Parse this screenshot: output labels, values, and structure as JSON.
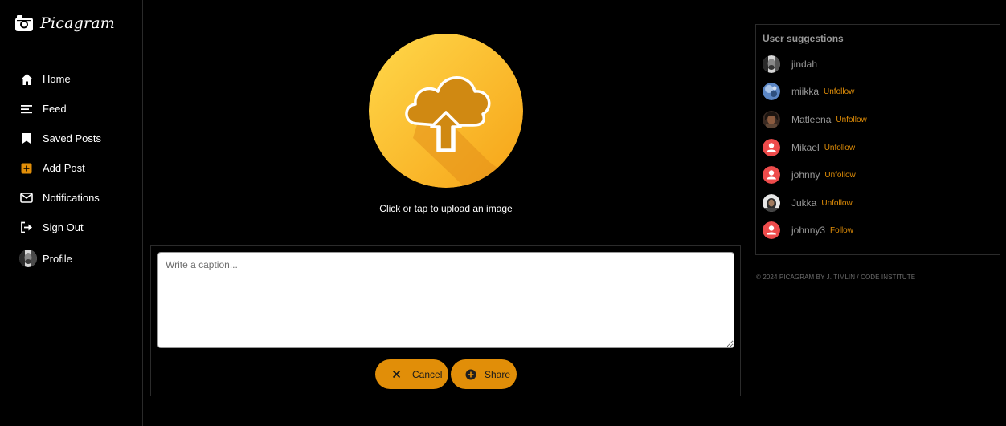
{
  "brand": {
    "name": "Picagram",
    "logo_icon": "camera-icon"
  },
  "nav": {
    "items": [
      {
        "label": "Home",
        "icon": "home-icon"
      },
      {
        "label": "Feed",
        "icon": "feed-icon"
      },
      {
        "label": "Saved Posts",
        "icon": "bookmark-icon"
      },
      {
        "label": "Add Post",
        "icon": "add-post-icon"
      },
      {
        "label": "Notifications",
        "icon": "mail-icon"
      },
      {
        "label": "Sign Out",
        "icon": "sign-out-icon"
      },
      {
        "label": "Profile",
        "icon": "avatar"
      }
    ]
  },
  "upload": {
    "text": "Click or tap to upload an image",
    "icon": "cloud-upload-icon"
  },
  "form": {
    "caption_placeholder": "Write a caption...",
    "caption_value": "",
    "cancel_label": "Cancel",
    "share_label": "Share"
  },
  "suggestions": {
    "title": "User suggestions",
    "users": [
      {
        "name": "jindah",
        "action": ""
      },
      {
        "name": "miikka",
        "action": "Unfollow"
      },
      {
        "name": "Matleena",
        "action": "Unfollow"
      },
      {
        "name": "Mikael",
        "action": "Unfollow"
      },
      {
        "name": "johnny",
        "action": "Unfollow"
      },
      {
        "name": "Jukka",
        "action": "Unfollow"
      },
      {
        "name": "johnny3",
        "action": "Follow"
      }
    ]
  },
  "footer": {
    "text": "© 2024 PICAGRAM BY J. TIMLIN / CODE INSTITUTE"
  },
  "colors": {
    "accent": "#e18e08",
    "background": "#000000",
    "muted": "#9a9a9a",
    "upload_circle": "#fbbf24"
  }
}
